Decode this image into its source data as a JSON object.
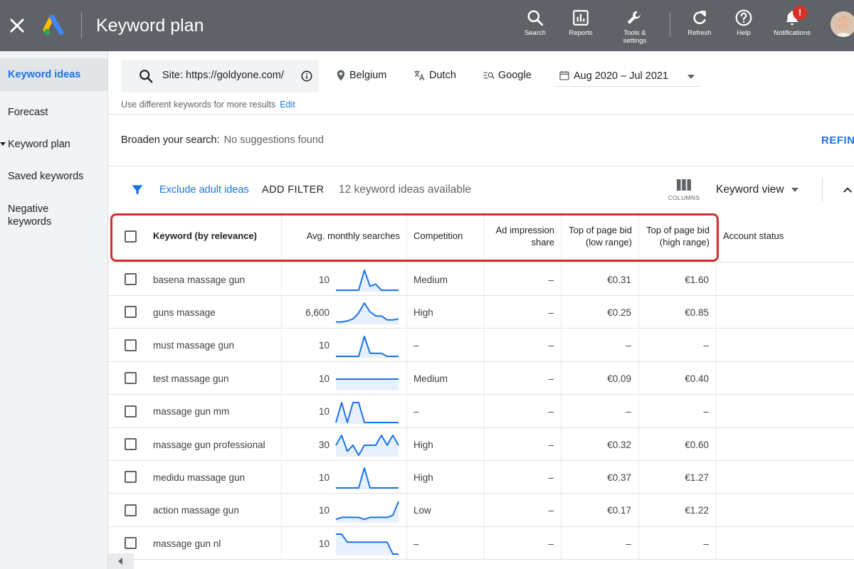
{
  "header": {
    "title": "Keyword plan",
    "actions": [
      {
        "label": "Search",
        "icon": "search-icon"
      },
      {
        "label": "Reports",
        "icon": "reports-icon"
      },
      {
        "label": "Tools & settings",
        "icon": "wrench-icon"
      },
      {
        "label": "Refresh",
        "icon": "refresh-icon"
      },
      {
        "label": "Help",
        "icon": "help-icon"
      },
      {
        "label": "Notifications",
        "icon": "bell-icon",
        "badge": "!"
      }
    ]
  },
  "sidebar": {
    "items": [
      {
        "label": "Keyword ideas",
        "active": true
      },
      {
        "label": "Forecast"
      },
      {
        "label": "Keyword plan"
      },
      {
        "label": "Saved keywords"
      },
      {
        "label": "Negative keywords"
      }
    ]
  },
  "search": {
    "value": "Site: https://goldyone.com/",
    "location": "Belgium",
    "language": "Dutch",
    "network": "Google",
    "date_range": "Aug 2020 – Jul 2021",
    "hint": "Use different keywords for more results",
    "hint_link": "Edit"
  },
  "broaden": {
    "label": "Broaden your search:",
    "value": "No suggestions found",
    "refine": "REFINE"
  },
  "toolbar": {
    "exclude": "Exclude adult ideas",
    "add_filter": "ADD FILTER",
    "available": "12 keyword ideas available",
    "columns": "COLUMNS",
    "view": "Keyword view"
  },
  "table": {
    "headers": {
      "keyword": "Keyword (by relevance)",
      "searches": "Avg. monthly searches",
      "competition": "Competition",
      "impression": "Ad impression share",
      "bid_low": "Top of page bid (low range)",
      "bid_high": "Top of page bid (high range)",
      "status": "Account status"
    },
    "rows": [
      {
        "keyword": "basena massage gun",
        "searches": "10",
        "trend": [
          0,
          0,
          0,
          0,
          0,
          1,
          0.2,
          0.3,
          0,
          0,
          0,
          0
        ],
        "competition": "Medium",
        "impression": "–",
        "bid_low": "€0.31",
        "bid_high": "€1.60"
      },
      {
        "keyword": "guns massage",
        "searches": "6,600",
        "trend": [
          0.05,
          0.05,
          0.1,
          0.2,
          0.5,
          1,
          0.55,
          0.35,
          0.35,
          0.15,
          0.15,
          0.2
        ],
        "competition": "High",
        "impression": "–",
        "bid_low": "€0.25",
        "bid_high": "€0.85"
      },
      {
        "keyword": "must massage gun",
        "searches": "10",
        "trend": [
          0,
          0,
          0,
          0,
          0,
          1,
          0.15,
          0.15,
          0.15,
          0,
          0,
          0
        ],
        "competition": "–",
        "impression": "–",
        "bid_low": "–",
        "bid_high": "–"
      },
      {
        "keyword": "test massage gun",
        "searches": "10",
        "trend": [
          0.5,
          0.5,
          0.5,
          0.5,
          0.5,
          0.5,
          0.5,
          0.5,
          0.5,
          0.5,
          0.5,
          0.5
        ],
        "competition": "Medium",
        "impression": "–",
        "bid_low": "€0.09",
        "bid_high": "€0.40"
      },
      {
        "keyword": "massage gun mm",
        "searches": "10",
        "trend": [
          0,
          1,
          0,
          1,
          1,
          0,
          0,
          0,
          0,
          0,
          0,
          0
        ],
        "competition": "–",
        "impression": "–",
        "bid_low": "–",
        "bid_high": "–"
      },
      {
        "keyword": "massage gun professional",
        "searches": "30",
        "trend": [
          0.5,
          1,
          0.2,
          0.5,
          0,
          0.5,
          0.5,
          0.5,
          1,
          0.5,
          1,
          0.5
        ],
        "competition": "High",
        "impression": "–",
        "bid_low": "€0.32",
        "bid_high": "€0.60"
      },
      {
        "keyword": "medidu massage gun",
        "searches": "10",
        "trend": [
          0,
          0,
          0,
          0,
          0,
          1,
          0,
          0,
          0,
          0,
          0,
          0
        ],
        "competition": "High",
        "impression": "–",
        "bid_low": "€0.37",
        "bid_high": "€1.27"
      },
      {
        "keyword": "action massage gun",
        "searches": "10",
        "trend": [
          0.1,
          0.2,
          0.2,
          0.2,
          0.2,
          0.1,
          0.2,
          0.2,
          0.2,
          0.2,
          0.3,
          1
        ],
        "competition": "Low",
        "impression": "–",
        "bid_low": "€0.17",
        "bid_high": "€1.22"
      },
      {
        "keyword": "massage gun nl",
        "searches": "10",
        "trend": [
          1,
          1,
          0.6,
          0.6,
          0.6,
          0.6,
          0.6,
          0.6,
          0.6,
          0.6,
          0,
          0
        ],
        "competition": "–",
        "impression": "–",
        "bid_low": "–",
        "bid_high": "–"
      }
    ]
  },
  "colors": {
    "topbar": "#5f6368",
    "accent": "#1a73e8",
    "highlight": "#d32f2f",
    "sparkline": "#1a73e8",
    "sparkline_fill": "#e8f0fe"
  }
}
